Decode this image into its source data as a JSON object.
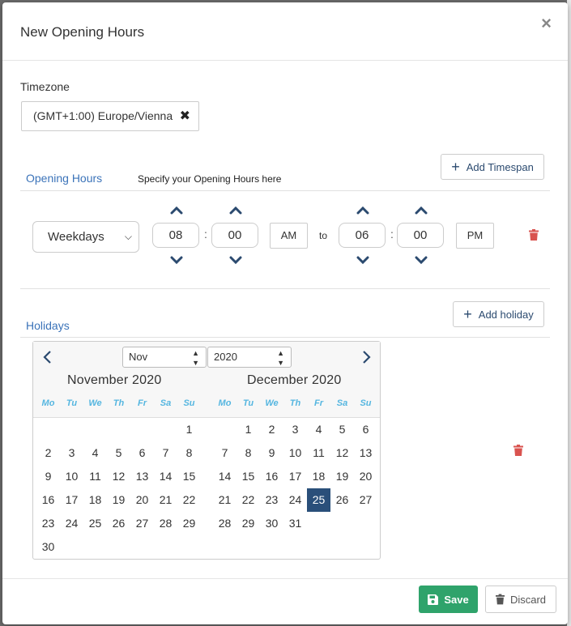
{
  "modal": {
    "title": "New Opening Hours",
    "close_label": "×"
  },
  "timezone": {
    "label": "Timezone",
    "value": "(GMT+1:00) Europe/Vienna",
    "clear_label": "✖"
  },
  "opening_hours": {
    "title": "Opening Hours",
    "hint": "Specify your Opening Hours here",
    "add_label": "Add Timespan",
    "row": {
      "days": "Weekdays",
      "start_hour": "08",
      "start_minute": "00",
      "start_period": "AM",
      "to_label": "to",
      "end_hour": "06",
      "end_minute": "00",
      "end_period": "PM"
    }
  },
  "holidays": {
    "title": "Holidays",
    "add_label": "Add holiday",
    "month_select": "Nov",
    "year_select": "2020",
    "weekday_labels": [
      "Mo",
      "Tu",
      "We",
      "Th",
      "Fr",
      "Sa",
      "Su"
    ],
    "months": [
      {
        "title": "November 2020",
        "first_weekday_index": 6,
        "days_in_month": 30
      },
      {
        "title": "December 2020",
        "first_weekday_index": 1,
        "days_in_month": 31
      }
    ],
    "selected": {
      "month_index": 1,
      "day": 25
    }
  },
  "footer": {
    "save_label": "Save",
    "discard_label": "Discard"
  },
  "colors": {
    "accent": "#3b73b9",
    "primary_dark": "#2a4f7a",
    "save_green": "#2fa36b",
    "delete_red": "#d9534f",
    "weekday_blue": "#55b6e0"
  },
  "icons": {
    "close": "close-icon",
    "clear": "clear-icon",
    "plus": "plus-icon",
    "chevron_up": "chevron-up-icon",
    "chevron_down": "chevron-down-icon",
    "trash": "trash-icon",
    "save": "floppy-disk-icon",
    "discard": "trash-icon"
  }
}
